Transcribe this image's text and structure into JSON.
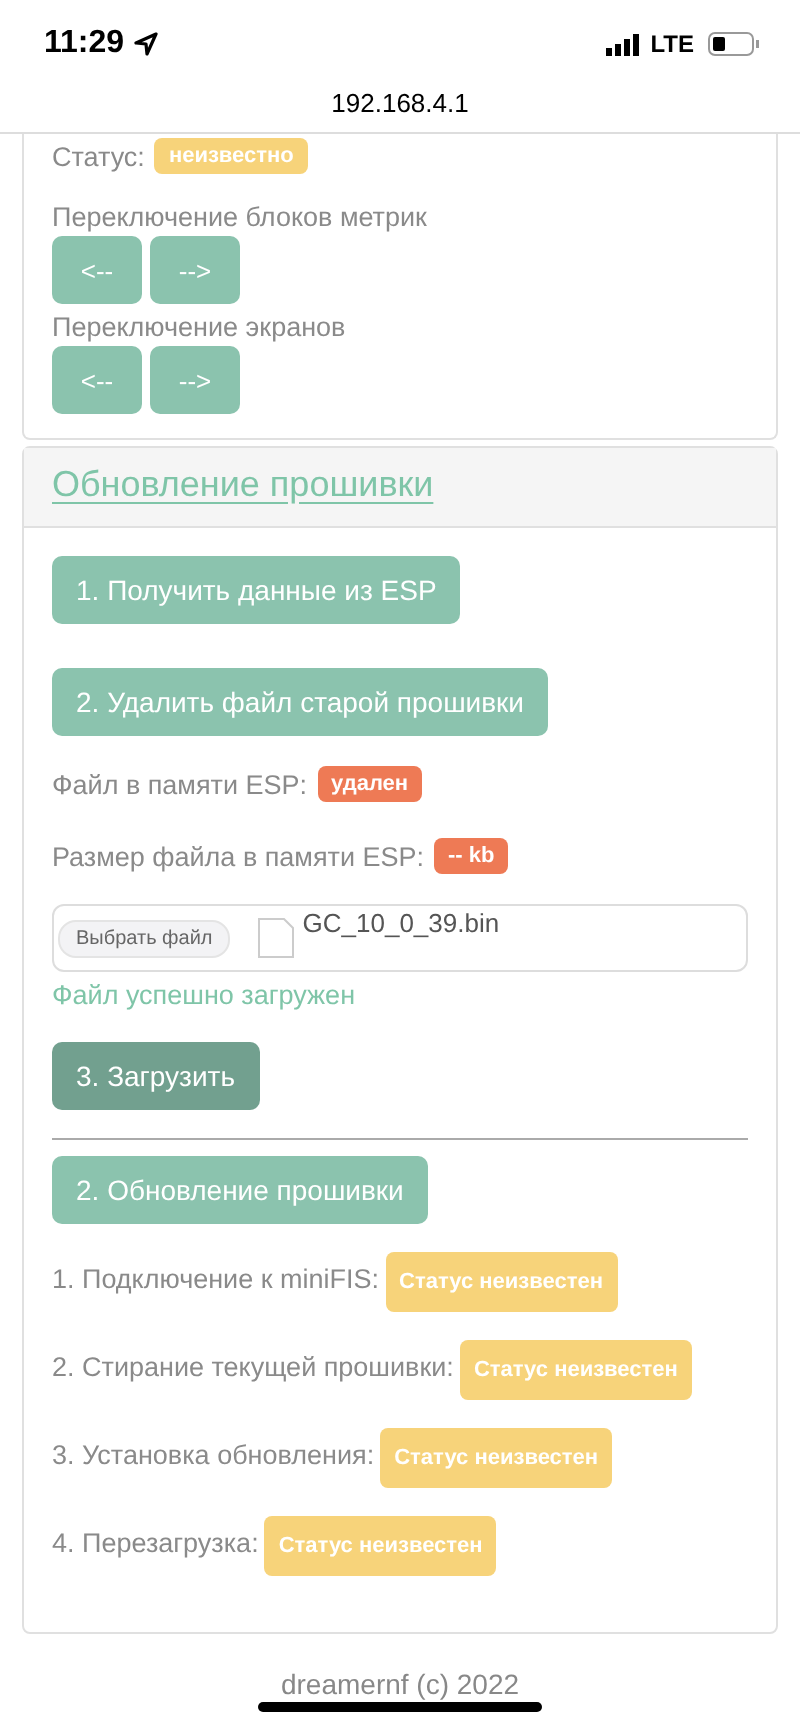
{
  "status_bar": {
    "time": "11:29",
    "network": "LTE",
    "location_on": true
  },
  "address_bar": {
    "url": "192.168.4.1"
  },
  "controls_card": {
    "status_label": "Статус:",
    "status_badge": {
      "text": "неизвестно",
      "kind": "warning"
    },
    "groups": [
      {
        "label": "Переключение блоков метрик",
        "buttons": [
          "<--",
          "-->"
        ]
      },
      {
        "label": "Переключение экранов",
        "buttons": [
          "<--",
          "-->"
        ]
      }
    ]
  },
  "firmware_card": {
    "title": "Обновление прошивки",
    "top_buttons": [
      "1. Получить данные из ESP",
      "2. Удалить файл старой прошивки"
    ],
    "info_rows": [
      {
        "label": "Файл в памяти ESP:",
        "badge": {
          "text": "удален",
          "kind": "danger"
        }
      },
      {
        "label": "Размер файла в памяти ESP:",
        "badge": {
          "text": "-- kb",
          "kind": "danger"
        }
      }
    ],
    "file_input": {
      "button": "Выбрать файл",
      "file_name": "GC_10_0_39.bin"
    },
    "upload_message": "Файл успешно загружен",
    "upload_button": {
      "label": "3. Загрузить",
      "pressed": true
    },
    "update_button": {
      "label": "2. Обновление прошивки",
      "pressed": false
    },
    "steps": [
      {
        "label": "1. Подключение к miniFIS:",
        "badge": {
          "text": "Статус неизвестен",
          "kind": "warning"
        }
      },
      {
        "label": "2. Стирание текущей прошивки:",
        "badge": {
          "text": "Статус неизвестен",
          "kind": "warning"
        }
      },
      {
        "label": "3. Установка обновления:",
        "badge": {
          "text": "Статус неизвестен",
          "kind": "warning"
        }
      },
      {
        "label": "4. Перезагрузка:",
        "badge": {
          "text": "Статус неизвестен",
          "kind": "warning"
        }
      }
    ]
  },
  "footer": "dreamernf (c) 2022"
}
